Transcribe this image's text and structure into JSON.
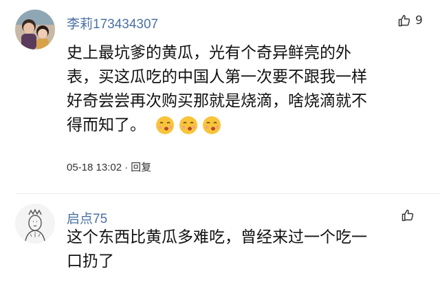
{
  "comments": [
    {
      "username": "李莉173434307",
      "like_count": "9",
      "line1": "史上最坑爹的黄瓜，光有个奇异鲜亮的外",
      "line2": "表，买这瓜吃的中国人第一次要不跟我一样",
      "line3": "好奇尝尝再次购买那就是烧滴，啥烧滴就不",
      "line4": "得而知了。",
      "emojis": [
        "whistle-emoji",
        "whistle-emoji",
        "whistle-emoji"
      ],
      "timestamp": "05-18 13:02",
      "separator": "·",
      "reply_label": "回复"
    },
    {
      "username": "启点75",
      "like_count": "",
      "line1": "这个东西比黄瓜多难吃，曾经来过一个吃一",
      "line2": "口扔了"
    }
  ],
  "colors": {
    "username": "#4a6fa3",
    "text": "#111111",
    "emoji_face": "#f8c43a"
  }
}
